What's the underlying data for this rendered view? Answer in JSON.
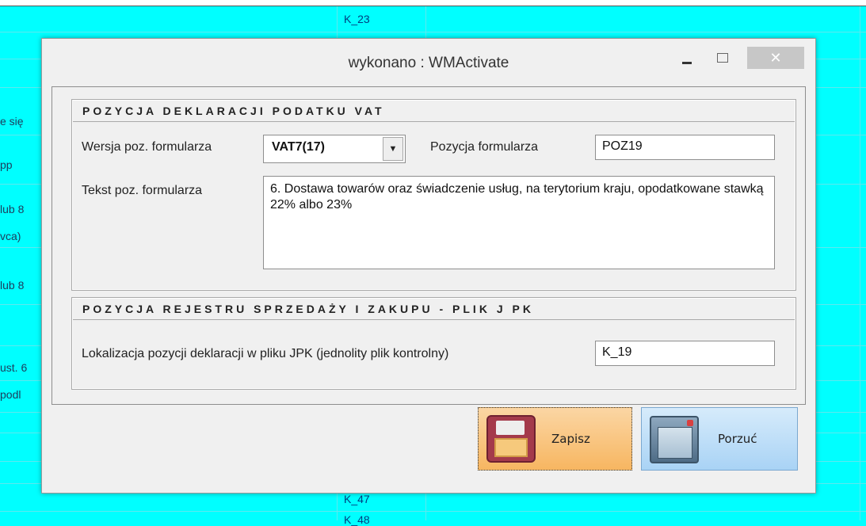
{
  "window": {
    "title": "wykonano : WMActivate",
    "close_glyph": "✕"
  },
  "background": {
    "k_codes": [
      "K_23",
      "K_47",
      "K_48"
    ],
    "left_fragments": [
      "e się",
      "pp",
      "lub 8",
      "vca)",
      "lub 8",
      "ust. 6",
      "podl"
    ]
  },
  "declaration_section": {
    "title": "POZYCJA DEKLARACJI PODATKU VAT",
    "version_label": "Wersja poz. formularza",
    "version_value": "VAT7(17)",
    "position_label": "Pozycja formularza",
    "position_value": "POZ19",
    "text_label": "Tekst poz. formularza",
    "text_value": "6. Dostawa towarów oraz świadczenie usług, na terytorium kraju, opodatkowane stawką 22% albo 23%"
  },
  "jpk_section": {
    "title": "POZYCJA REJESTRU SPRZEDAŻY I ZAKUPU - PLIK J PK",
    "location_label": "Lokalizacja pozycji deklaracji w pliku JPK (jednolity plik kontrolny)",
    "location_value": "K_19"
  },
  "buttons": {
    "save_label": "Zapisz",
    "cancel_label": "Porzuć"
  },
  "icons": {
    "save": "floppy-disk-icon",
    "cancel": "window-close-icon",
    "dropdown": "chevron-down-icon"
  }
}
